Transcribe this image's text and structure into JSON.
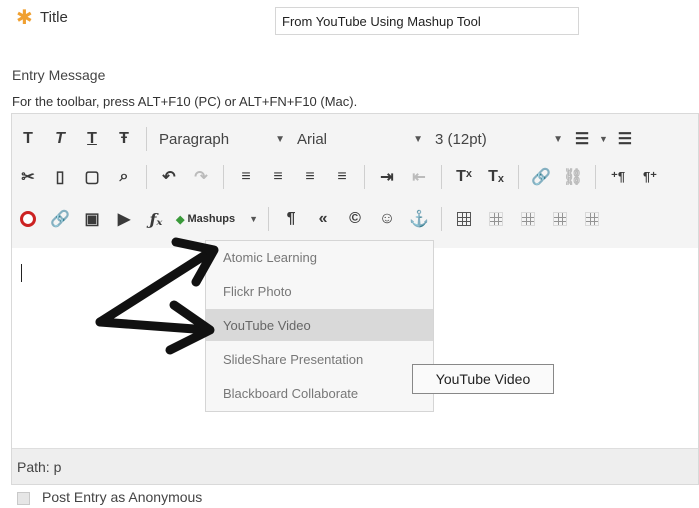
{
  "form": {
    "required_marker": "✱",
    "title_label": "Title",
    "title_value": "From YouTube Using Mashup Tool",
    "entry_message_label": "Entry Message",
    "toolbar_hint": "For the toolbar, press ALT+F10 (PC) or ALT+FN+F10 (Mac).",
    "anonymous_label": "Post Entry as Anonymous",
    "anonymous_checked": false
  },
  "toolbar": {
    "row1": {
      "buttons": [
        "T",
        "T",
        "T",
        "Ŧ"
      ],
      "format_select": "Paragraph",
      "font_select": "Arial",
      "size_select": "3 (12pt)"
    },
    "row3": {
      "mashups_label": "Mashups",
      "symbols": [
        "¶",
        "«",
        "©",
        "☺",
        "⚓"
      ]
    }
  },
  "mashups_menu": {
    "items": [
      "Atomic Learning",
      "Flickr Photo",
      "YouTube Video",
      "SlideShare Presentation",
      "Blackboard Collaborate"
    ],
    "highlighted_index": 2,
    "tooltip": "YouTube Video"
  },
  "editor": {
    "path_label": "Path:",
    "path_value": "p"
  },
  "colors": {
    "required": "#f0a030",
    "arrow": "#111111",
    "record_icon": "#cc2222"
  }
}
